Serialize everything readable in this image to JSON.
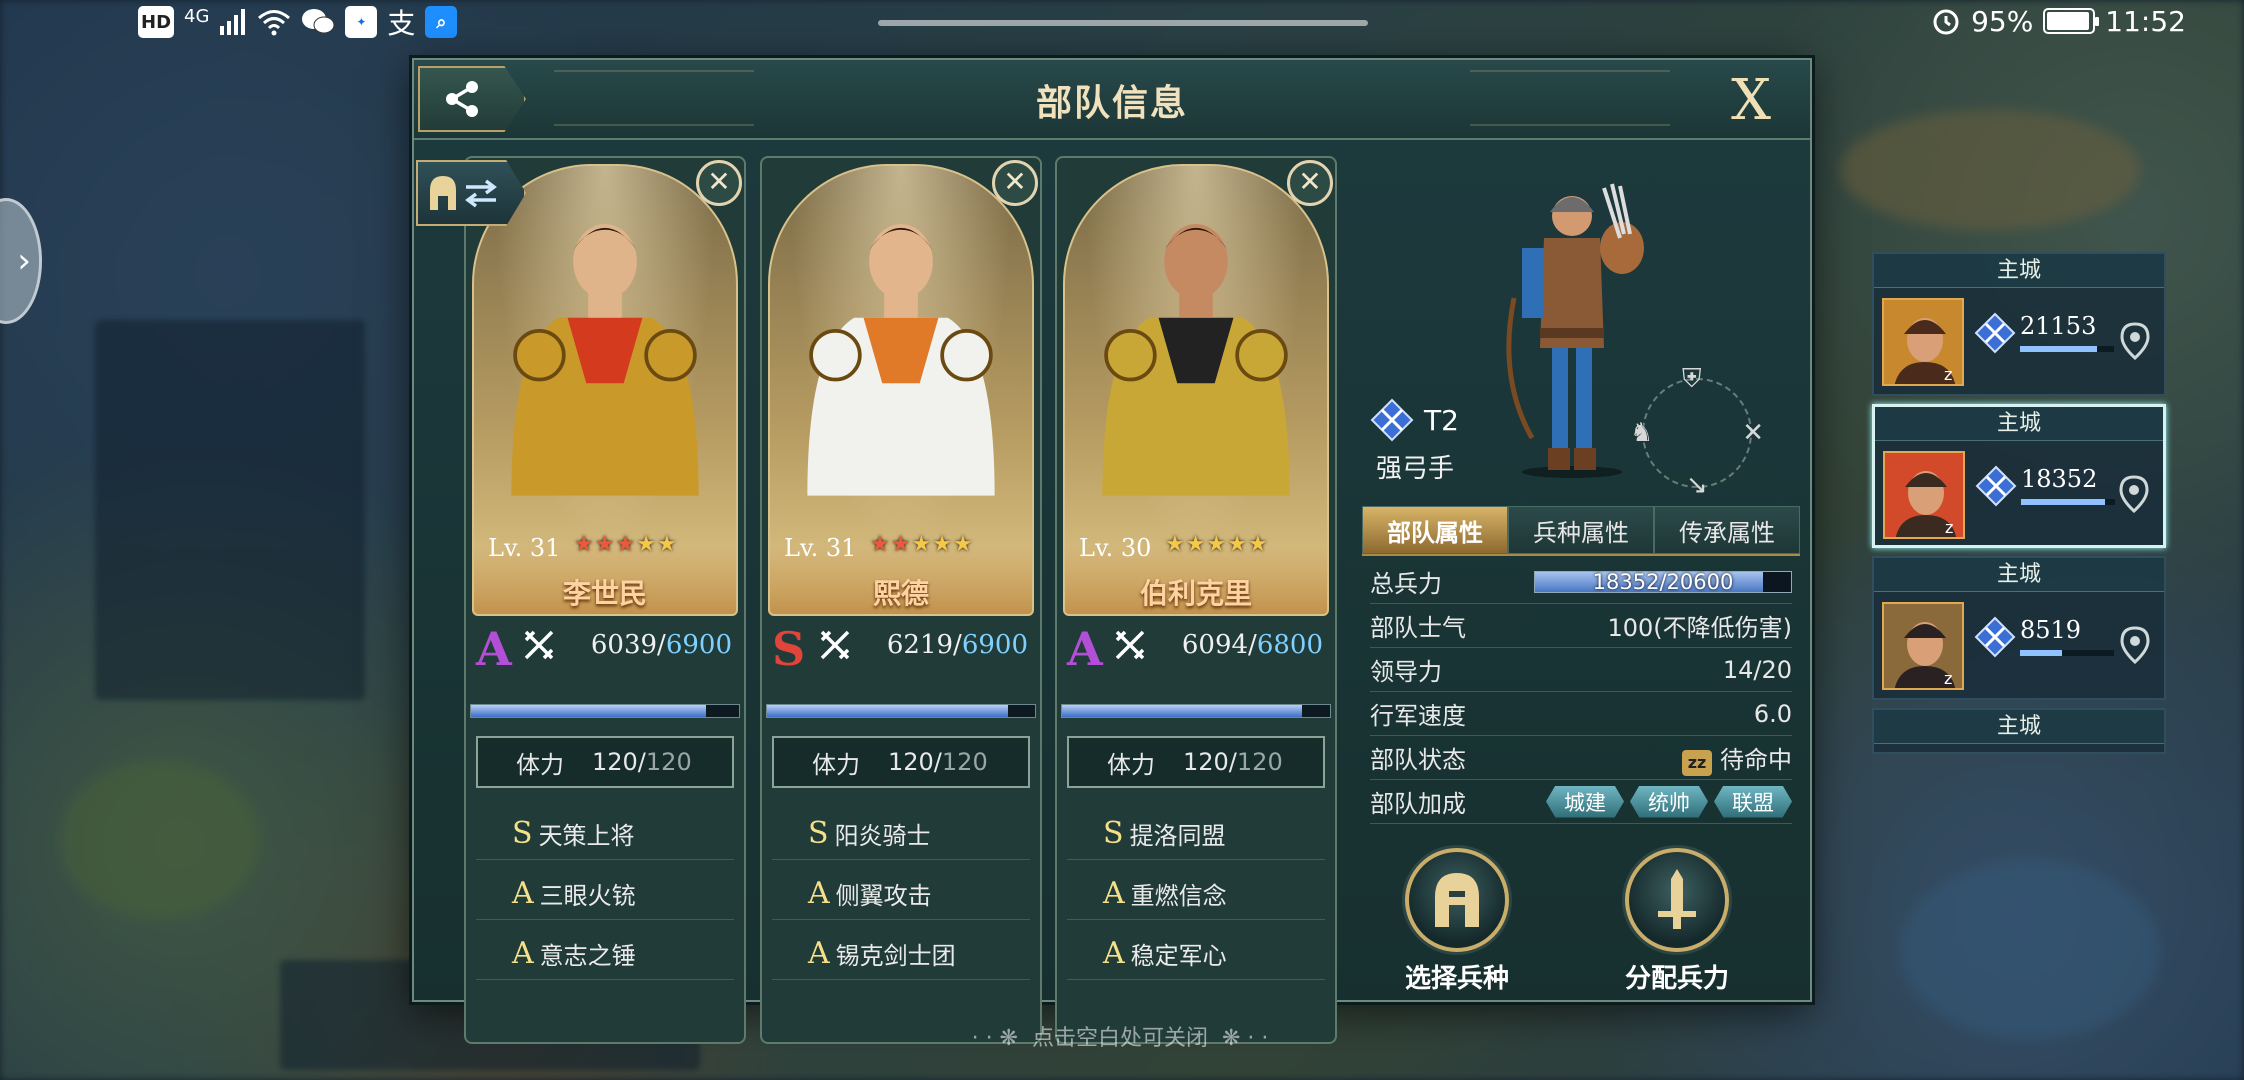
{
  "status_bar": {
    "left_icons": [
      "hd-icon",
      "4g-icon",
      "signal-icon",
      "wifi-icon",
      "wechat-icon",
      "app-icon",
      "alipay-icon",
      "search-app-icon"
    ],
    "hd": "HD",
    "network": "4G",
    "battery": "95%",
    "battery_level": 0.95,
    "time": "11:52"
  },
  "dialog": {
    "title": "部队信息",
    "close_label": "X"
  },
  "heroes": [
    {
      "name": "李世民",
      "level": "Lv. 31",
      "stars": 5,
      "red_stars": 3,
      "rank": "A",
      "troops_current": "6039",
      "troops_max": "6900",
      "troops_ratio": 0.875,
      "stamina_label": "体力",
      "stamina_current": "120",
      "stamina_max": "120",
      "skills": [
        {
          "grade": "S",
          "name": "天策上将"
        },
        {
          "grade": "A",
          "name": "三眼火铳"
        },
        {
          "grade": "A",
          "name": "意志之锤"
        }
      ]
    },
    {
      "name": "熙德",
      "level": "Lv. 31",
      "stars": 5,
      "red_stars": 2,
      "rank": "S",
      "troops_current": "6219",
      "troops_max": "6900",
      "troops_ratio": 0.901,
      "stamina_label": "体力",
      "stamina_current": "120",
      "stamina_max": "120",
      "skills": [
        {
          "grade": "S",
          "name": "阳炎骑士"
        },
        {
          "grade": "A",
          "name": "侧翼攻击"
        },
        {
          "grade": "A",
          "name": "锡克剑士团"
        }
      ]
    },
    {
      "name": "伯利克里",
      "level": "Lv. 30",
      "stars": 5,
      "red_stars": 0,
      "rank": "A",
      "troops_current": "6094",
      "troops_max": "6800",
      "troops_ratio": 0.896,
      "stamina_label": "体力",
      "stamina_current": "120",
      "stamina_max": "120",
      "skills": [
        {
          "grade": "S",
          "name": "提洛同盟"
        },
        {
          "grade": "A",
          "name": "重燃信念"
        },
        {
          "grade": "A",
          "name": "稳定军心"
        }
      ]
    }
  ],
  "unit": {
    "tier": "T2",
    "name": "强弓手",
    "tabs": [
      "部队属性",
      "兵种属性",
      "传承属性"
    ],
    "active_tab": 0,
    "attributes": {
      "total_troops_label": "总兵力",
      "total_troops": "18352/20600",
      "total_troops_ratio": 0.891,
      "morale_label": "部队士气",
      "morale": "100(不降低伤害)",
      "leadership_label": "领导力",
      "leadership": "14/20",
      "speed_label": "行军速度",
      "speed": "6.0",
      "state_label": "部队状态",
      "state_icon": "zz",
      "state": "待命中",
      "bonus_label": "部队加成",
      "bonus": [
        "城建",
        "统帅",
        "联盟"
      ]
    },
    "select_unit_label": "选择兵种",
    "assign_troops_label": "分配兵力"
  },
  "close_hint": "点击空白处可关闭",
  "queue": [
    {
      "title": "主城",
      "count": "21153",
      "ratio": 0.82,
      "unit_icon": "crossbow-icon"
    },
    {
      "title": "主城",
      "count": "18352",
      "ratio": 0.89,
      "unit_icon": "crossbow-icon",
      "active": true
    },
    {
      "title": "主城",
      "count": "8519",
      "ratio": 0.45,
      "unit_icon": "cavalry-icon"
    },
    {
      "title": "主城"
    }
  ]
}
